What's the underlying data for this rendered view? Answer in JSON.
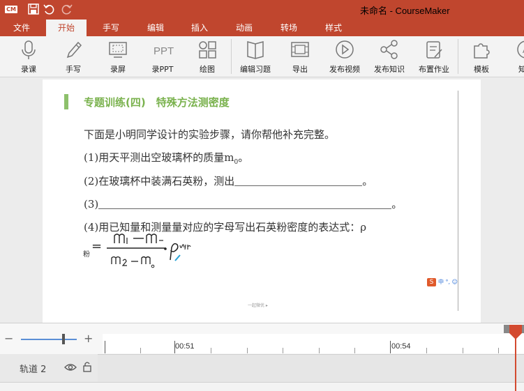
{
  "window": {
    "title": "未命名 - CourseMaker",
    "logo_text": "CM",
    "accent": "#c0462e"
  },
  "menu": {
    "tabs": [
      "文件",
      "开始",
      "手写",
      "编辑",
      "插入",
      "动画",
      "转场",
      "样式"
    ],
    "active": "开始"
  },
  "ribbon": {
    "buttons": [
      {
        "label": "录课",
        "icon": "microphone-icon"
      },
      {
        "label": "手写",
        "icon": "pen-icon"
      },
      {
        "label": "录屏",
        "icon": "screen-capture-icon"
      },
      {
        "label": "录PPT",
        "icon": "ppt-icon"
      },
      {
        "label": "绘图",
        "icon": "shapes-icon"
      },
      {
        "label": "编辑习题",
        "icon": "book-icon"
      },
      {
        "label": "导出",
        "icon": "export-film-icon"
      },
      {
        "label": "发布视频",
        "icon": "play-circle-icon"
      },
      {
        "label": "发布知识",
        "icon": "share-icon"
      },
      {
        "label": "布置作业",
        "icon": "homework-icon"
      },
      {
        "label": "模板",
        "icon": "puzzle-icon"
      },
      {
        "label": "知识",
        "icon": "knowledge-icon"
      }
    ],
    "ppt_icon_text": "PPT"
  },
  "slide": {
    "heading": "专题训练(四)　特殊方法测密度",
    "intro": "下面是小明同学设计的实验步骤，请你帮他补充完整。",
    "step1": "(1)用天平测出空玻璃杯的质量m",
    "step1_sub": "0",
    "step1_end": "。",
    "step2": "(2)在玻璃杯中装满石英粉，测出",
    "step2_end": "。",
    "step3": "(3)",
    "step3_end": "。",
    "step4": "(4)用已知量和测量量对应的字母写出石英粉密度的表达式：ρ",
    "rho_sub": "粉",
    "equals": "=",
    "ime_text": "中 °, ☺",
    "watermark": "一起微优 ▸"
  },
  "timeline": {
    "zoom_minus": "−",
    "zoom_plus": "+",
    "zoom_level": 0.8,
    "time_labels": [
      "00:51",
      "00:54"
    ],
    "track_name": "轨道 2"
  }
}
